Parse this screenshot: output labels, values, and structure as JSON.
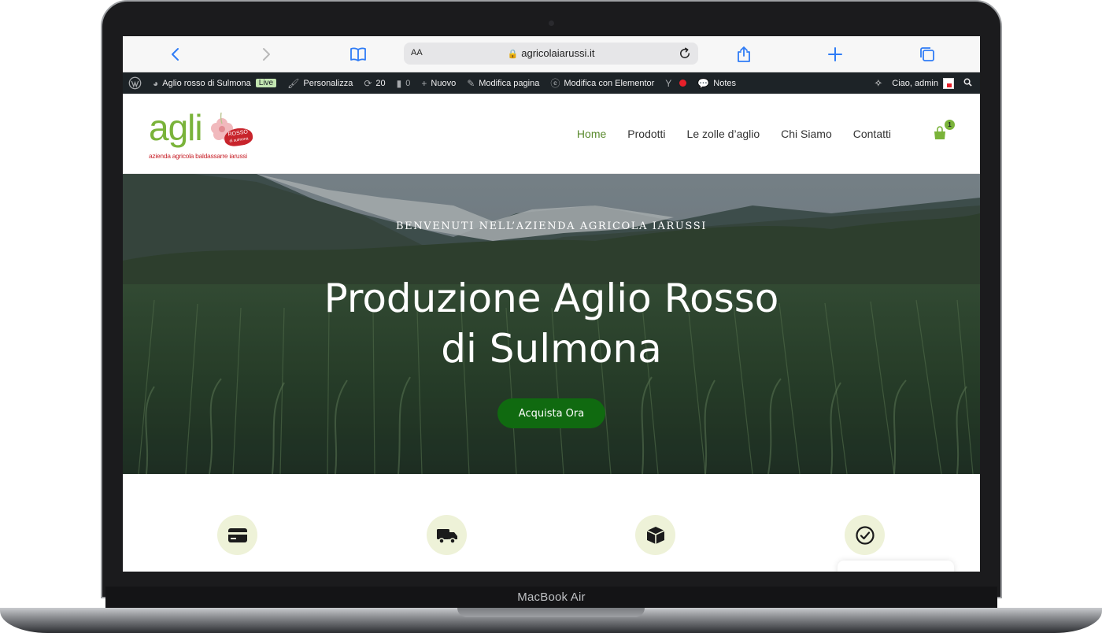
{
  "device": {
    "label": "MacBook Air"
  },
  "browser": {
    "url": "agricolaiarussi.it",
    "text_size_label": "AA"
  },
  "admin_bar": {
    "site_name": "Aglio rosso di Sulmona",
    "live_badge": "Live",
    "customize": "Personalizza",
    "updates_count": "20",
    "comments_count": "0",
    "new": "Nuovo",
    "edit_page": "Modifica pagina",
    "edit_elementor": "Modifica con Elementor",
    "notes": "Notes",
    "greeting": "Ciao, admin"
  },
  "logo": {
    "word": "agli",
    "badge_line1": "ROSSO",
    "badge_line2": "di sulmona",
    "tagline": "azienda agricola baldassarre iarussi"
  },
  "nav": {
    "items": [
      "Home",
      "Prodotti",
      "Le zolle d’aglio",
      "Chi Siamo",
      "Contatti"
    ],
    "active_index": 0,
    "cart_count": "1"
  },
  "hero": {
    "kicker": "BENVENUTI NELL’AZIENDA AGRICOLA IARUSSI",
    "title_line1": "Produzione Aglio Rosso",
    "title_line2": "di Sulmona",
    "cta": "Acquista Ora"
  },
  "features": {
    "icons": [
      "credit-card-icon",
      "truck-icon",
      "box-icon",
      "check-circle-icon"
    ]
  },
  "colors": {
    "accent_green": "#7ab33a",
    "cta_green": "#106a10",
    "admin_bar_bg": "#1d2327",
    "feature_circle": "#eef2d8",
    "logo_red": "#c8242c"
  }
}
